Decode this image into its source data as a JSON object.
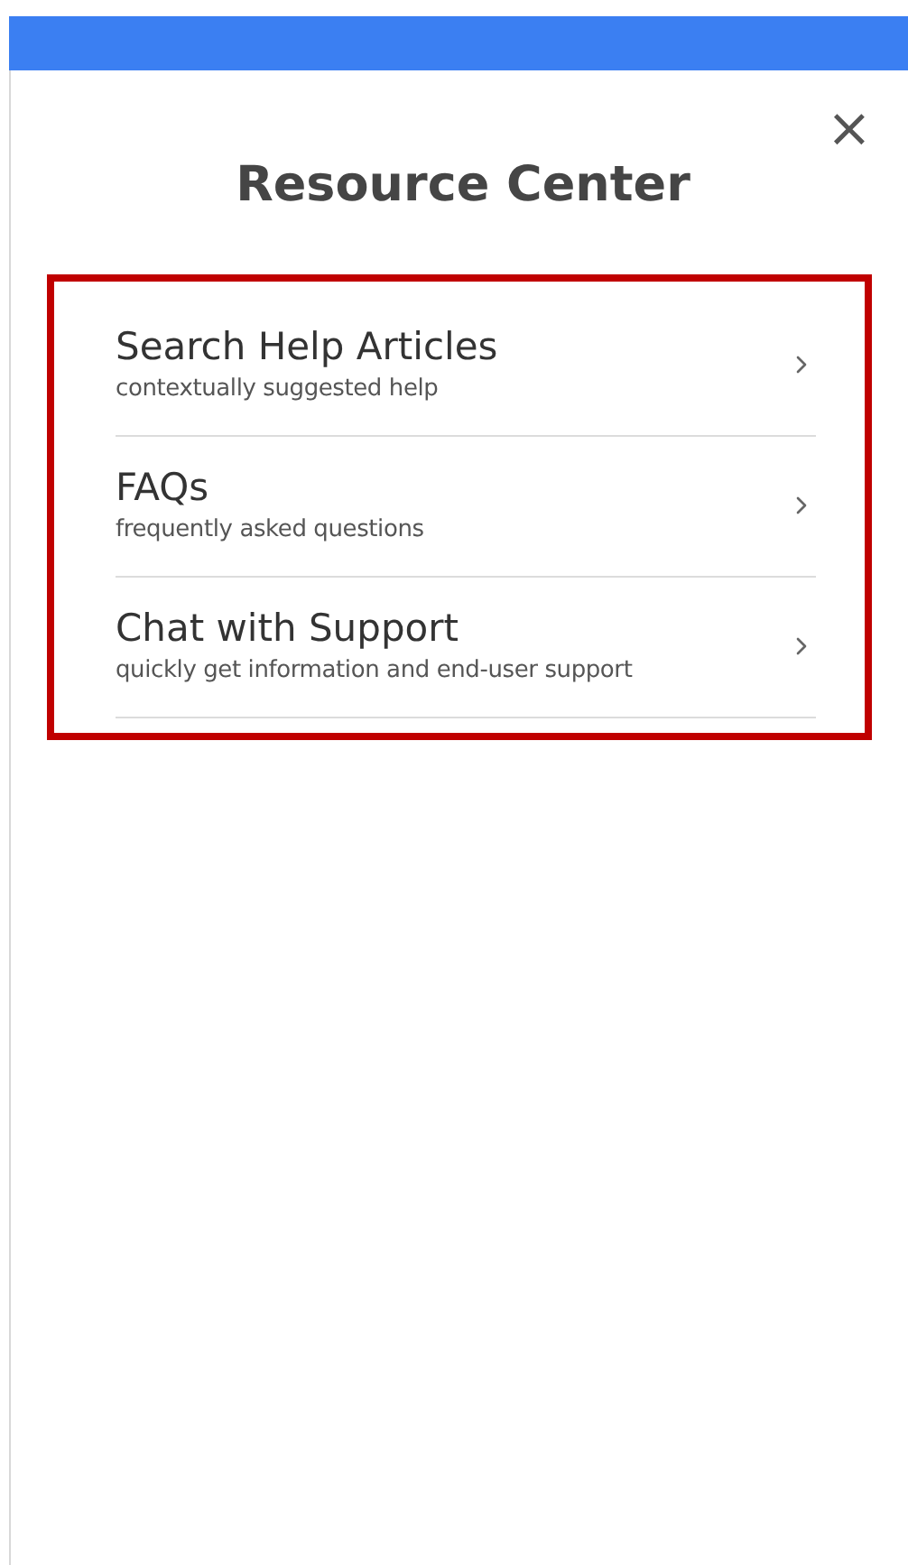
{
  "panel": {
    "title": "Resource Center",
    "close": "×"
  },
  "items": [
    {
      "title": "Search Help Articles",
      "subtitle": "contextually suggested help"
    },
    {
      "title": "FAQs",
      "subtitle": "frequently asked questions"
    },
    {
      "title": "Chat with Support",
      "subtitle": "quickly get information and end-user support"
    }
  ]
}
